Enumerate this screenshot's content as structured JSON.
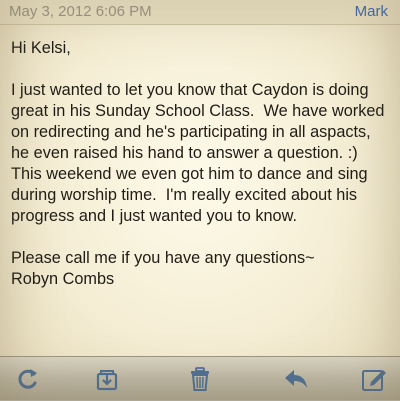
{
  "header": {
    "date": "May 3, 2012 6:06 PM",
    "sender": "Mark"
  },
  "message": {
    "greeting": "Hi Kelsi,",
    "paragraph1": "I just wanted to let you know that Caydon is doing great in his Sunday School Class.  We have worked on redirecting and he's participating in all aspacts, he even raised his hand to answer a question. :)",
    "paragraph2": "This weekend we even got him to dance and sing during worship time.  I'm really excited about his progress and I just wanted you to know.",
    "closing": "Please call me if you have any questions~",
    "signature": "Robyn Combs"
  },
  "toolbar": {
    "items": [
      {
        "icon": "refresh-icon"
      },
      {
        "icon": "move-to-folder-icon"
      },
      {
        "icon": "trash-icon"
      },
      {
        "icon": "reply-icon"
      },
      {
        "icon": "compose-icon"
      }
    ]
  },
  "colors": {
    "sender_link": "#3a67b0",
    "toolbar_icon": "#4e6f95"
  }
}
